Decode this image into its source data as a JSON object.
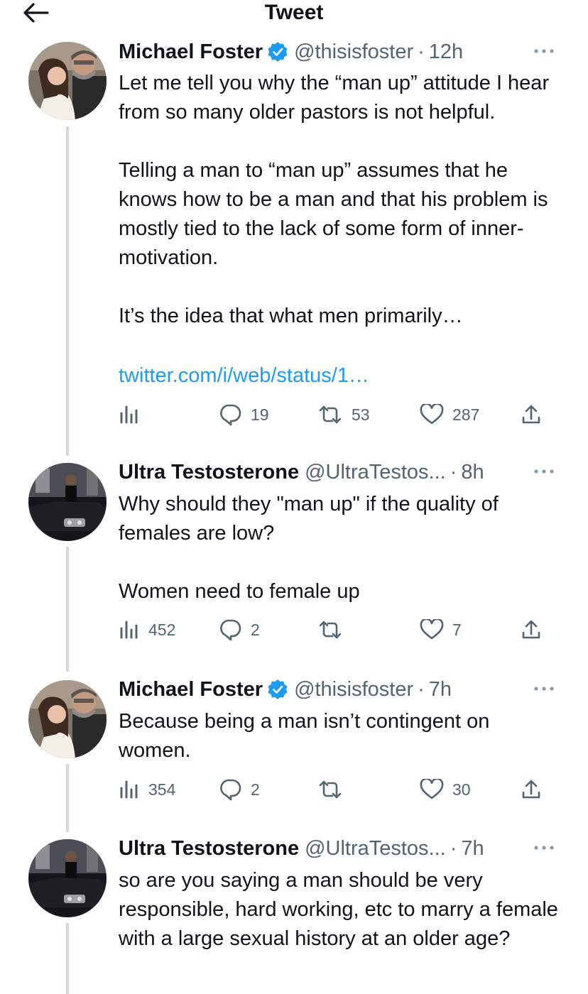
{
  "header": {
    "title": "Tweet",
    "back_icon": "arrow-left-icon"
  },
  "colors": {
    "link": "#1d9bf0",
    "secondary": "#536471",
    "verified": "#1d9bf0",
    "thread_line": "#cfd9de"
  },
  "tweets": [
    {
      "name": "Michael Foster",
      "verified": true,
      "handle": "@thisisfoster",
      "separator": "·",
      "time": "12h",
      "text": "Let me tell you why the “man up” attitude I hear from so many older pastors is not helpful.\n\nTelling a man to “man up” assumes that he knows how to be a man and that his problem is mostly tied to the lack of some form of inner-motivation.\n\nIt’s the idea that what men primarily…",
      "link": "twitter.com/i/web/status/1…",
      "views": "",
      "replies": "19",
      "retweets": "53",
      "likes": "287"
    },
    {
      "name": "Ultra Testosterone",
      "verified": false,
      "handle": "@UltraTestos...",
      "separator": "·",
      "time": "8h",
      "text": "Why should they \"man up\" if the quality of females are low?\n\nWomen need to female up",
      "views": "452",
      "replies": "2",
      "retweets": "",
      "likes": "7"
    },
    {
      "name": "Michael Foster",
      "verified": true,
      "handle": "@thisisfoster",
      "separator": "·",
      "time": "7h",
      "text": "Because being a man isn’t contingent on women.",
      "views": "354",
      "replies": "2",
      "retweets": "",
      "likes": "30"
    },
    {
      "name": "Ultra Testosterone",
      "verified": false,
      "handle": "@UltraTestos...",
      "separator": "·",
      "time": "7h",
      "text": "so are you saying a man should be very responsible, hard working, etc to marry a female with a large sexual history at an older age?"
    }
  ]
}
